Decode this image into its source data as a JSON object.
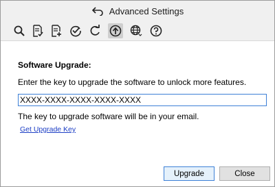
{
  "window": {
    "title": "Advanced Settings"
  },
  "toolbar": {
    "icons": [
      "search-icon",
      "document-check-icon",
      "document-add-icon",
      "check-circle-icon",
      "refresh-icon",
      "upgrade-icon",
      "globe-icon",
      "help-icon"
    ],
    "active": "upgrade-icon"
  },
  "upgrade": {
    "heading": "Software Upgrade:",
    "instructions": "Enter the key to upgrade the software to unlock more features.",
    "key_value": "XXXX-XXXX-XXXX-XXXX-XXXX",
    "hint": "The key to upgrade software will be in your email.",
    "link_label": "Get Upgrade Key"
  },
  "buttons": {
    "upgrade_label": "Upgrade",
    "close_label": "Close"
  },
  "colors": {
    "accent": "#3c7fd6",
    "link": "#1a3cc4",
    "toolbar_bg": "#f0f0f0"
  }
}
